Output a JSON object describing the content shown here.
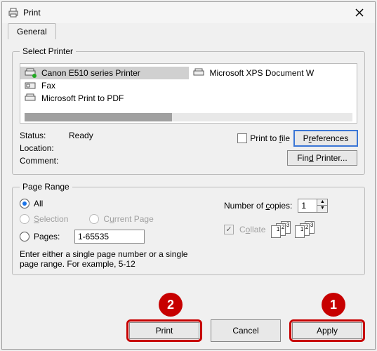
{
  "window": {
    "title": "Print"
  },
  "tab": {
    "general": "General"
  },
  "select_printer": {
    "legend": "Select Printer",
    "items": [
      {
        "name": "Canon E510 series Printer",
        "selected": true
      },
      {
        "name": "Fax",
        "selected": false
      },
      {
        "name": "Microsoft Print to PDF",
        "selected": false
      },
      {
        "name": "Microsoft XPS Document W",
        "selected": false
      }
    ]
  },
  "status": {
    "status_label": "Status:",
    "status_value": "Ready",
    "location_label": "Location:",
    "location_value": "",
    "comment_label": "Comment:",
    "comment_value": ""
  },
  "print_to_file": {
    "label_pre": "Print to ",
    "label_u": "f",
    "label_post": "ile"
  },
  "preferences_btn": {
    "pre": "P",
    "u": "r",
    "post": "eferences"
  },
  "find_printer_btn": {
    "pre": "Fin",
    "u": "d",
    "post": " Printer..."
  },
  "page_range": {
    "legend": "Page Range",
    "all": "All",
    "selection": {
      "u": "S",
      "post": "election"
    },
    "current_page": {
      "pre": "C",
      "u": "u",
      "post": "rrent Page"
    },
    "pages": "Pages:",
    "pages_value": "1-65535",
    "help": "Enter either a single page number or a single page range.  For example, 5-12"
  },
  "copies": {
    "label_pre": "Number of ",
    "label_u": "c",
    "label_post": "opies:",
    "value": "1",
    "collate_pre": "C",
    "collate_u": "o",
    "collate_post": "llate"
  },
  "buttons": {
    "print": "Print",
    "cancel": "Cancel",
    "apply": "Apply"
  },
  "annotations": {
    "one": "1",
    "two": "2"
  }
}
